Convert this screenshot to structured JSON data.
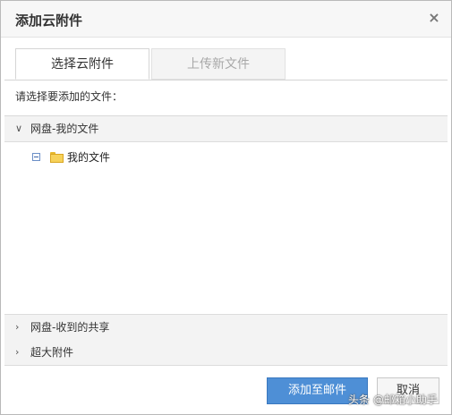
{
  "dialog": {
    "title": "添加云附件",
    "close_symbol": "×"
  },
  "tabs": [
    {
      "label": "选择云附件",
      "active": true
    },
    {
      "label": "上传新文件",
      "active": false
    }
  ],
  "prompt": "请选择要添加的文件：",
  "sections": [
    {
      "label": "网盘-我的文件",
      "expanded": true,
      "chevron": "∨"
    },
    {
      "label": "网盘-收到的共享",
      "expanded": false,
      "chevron": "›"
    },
    {
      "label": "超大附件",
      "expanded": false,
      "chevron": "›"
    }
  ],
  "tree": {
    "items": [
      {
        "label": "我的文件",
        "icon": "folder-icon",
        "expanded": true
      }
    ]
  },
  "buttons": {
    "primary_label": "添加至邮件",
    "cancel_label": "取消"
  },
  "watermark": "头条 @邮箱小助手",
  "colors": {
    "primary": "#4e8fd6",
    "folder": "#f7d25a"
  }
}
